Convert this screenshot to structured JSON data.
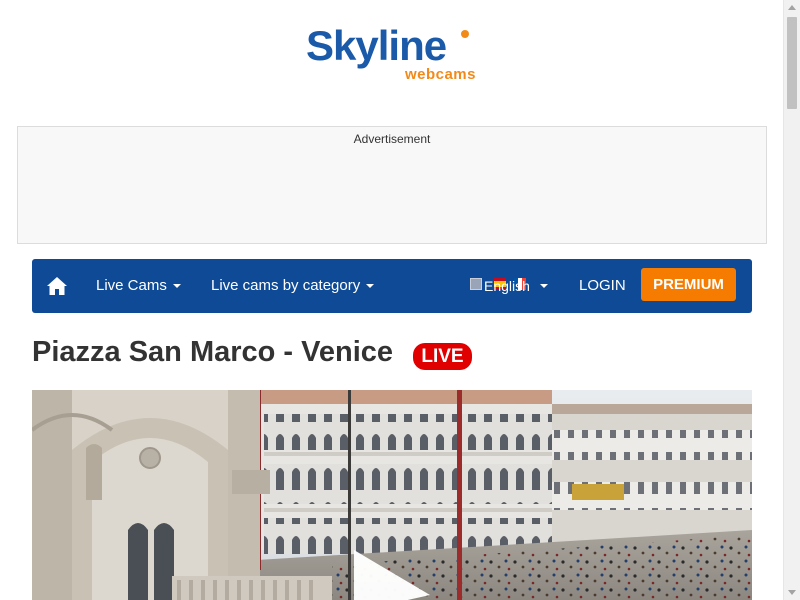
{
  "logo": {
    "main": "Skyline",
    "sub": "webcams"
  },
  "advertisement": {
    "label": "Advertisement"
  },
  "nav": {
    "home_icon": "home-icon",
    "items": [
      {
        "label": "Live Cams"
      },
      {
        "label": "Live cams by category"
      }
    ],
    "language": "English",
    "login": "LOGIN",
    "premium": "PREMIUM"
  },
  "page": {
    "title": "Piazza San Marco - Venice",
    "live_badge": "LIVE"
  },
  "webcam": {
    "play_icon": "play-icon"
  },
  "colors": {
    "brand_blue": "#1b5aa8",
    "brand_orange": "#f28a1a",
    "nav_bg": "#0e4a95",
    "premium": "#f57c00",
    "live": "#e00000"
  }
}
